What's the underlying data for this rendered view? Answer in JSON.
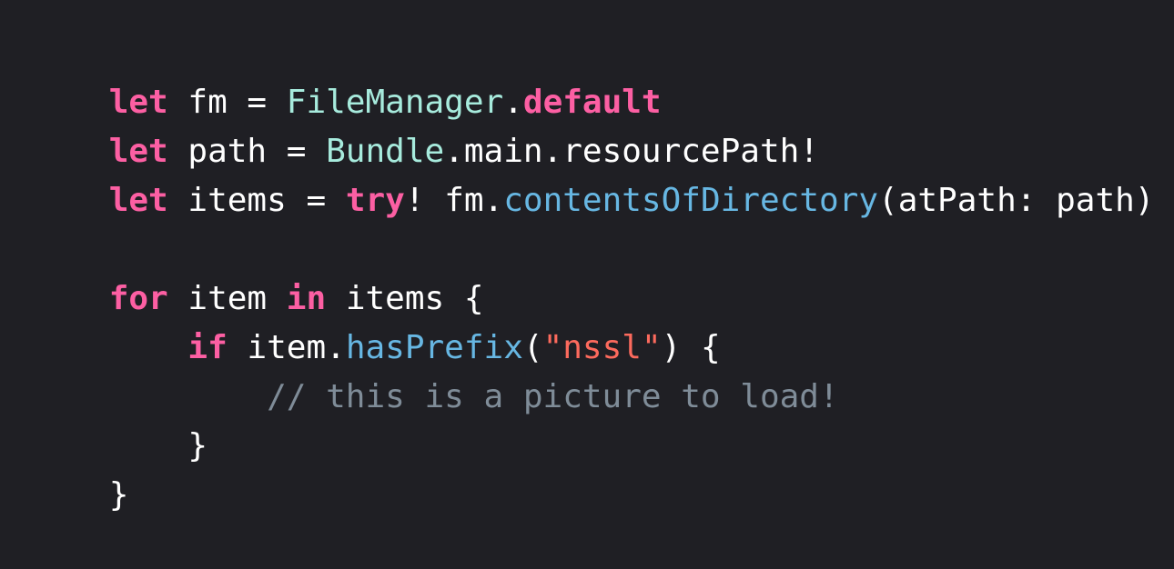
{
  "editor": {
    "background": "#1f1f24",
    "colors": {
      "plain": "#ffffff",
      "keyword": "#fc5fa3",
      "type": "#a7ebdd",
      "function": "#67b7e3",
      "string": "#fc6a5d",
      "comment": "#7f8c98"
    },
    "lines": [
      [
        {
          "text": "let",
          "kind": "keyword"
        },
        {
          "text": " fm = ",
          "kind": "plain"
        },
        {
          "text": "FileManager",
          "kind": "type"
        },
        {
          "text": ".",
          "kind": "plain"
        },
        {
          "text": "default",
          "kind": "keyword"
        }
      ],
      [
        {
          "text": "let",
          "kind": "keyword"
        },
        {
          "text": " path = ",
          "kind": "plain"
        },
        {
          "text": "Bundle",
          "kind": "type"
        },
        {
          "text": ".main.resourcePath!",
          "kind": "plain"
        }
      ],
      [
        {
          "text": "let",
          "kind": "keyword"
        },
        {
          "text": " items = ",
          "kind": "plain"
        },
        {
          "text": "try",
          "kind": "keyword"
        },
        {
          "text": "! fm.",
          "kind": "plain"
        },
        {
          "text": "contentsOfDirectory",
          "kind": "function"
        },
        {
          "text": "(atPath: path)",
          "kind": "plain"
        }
      ],
      [],
      [
        {
          "text": "for",
          "kind": "keyword"
        },
        {
          "text": " item ",
          "kind": "plain"
        },
        {
          "text": "in",
          "kind": "keyword"
        },
        {
          "text": " items {",
          "kind": "plain"
        }
      ],
      [
        {
          "text": "    ",
          "kind": "plain"
        },
        {
          "text": "if",
          "kind": "keyword"
        },
        {
          "text": " item.",
          "kind": "plain"
        },
        {
          "text": "hasPrefix",
          "kind": "function"
        },
        {
          "text": "(",
          "kind": "plain"
        },
        {
          "text": "\"nssl\"",
          "kind": "string"
        },
        {
          "text": ") {",
          "kind": "plain"
        }
      ],
      [
        {
          "text": "        ",
          "kind": "plain"
        },
        {
          "text": "// this is a picture to load!",
          "kind": "comment"
        }
      ],
      [
        {
          "text": "    }",
          "kind": "plain"
        }
      ],
      [
        {
          "text": "}",
          "kind": "plain"
        }
      ]
    ]
  }
}
